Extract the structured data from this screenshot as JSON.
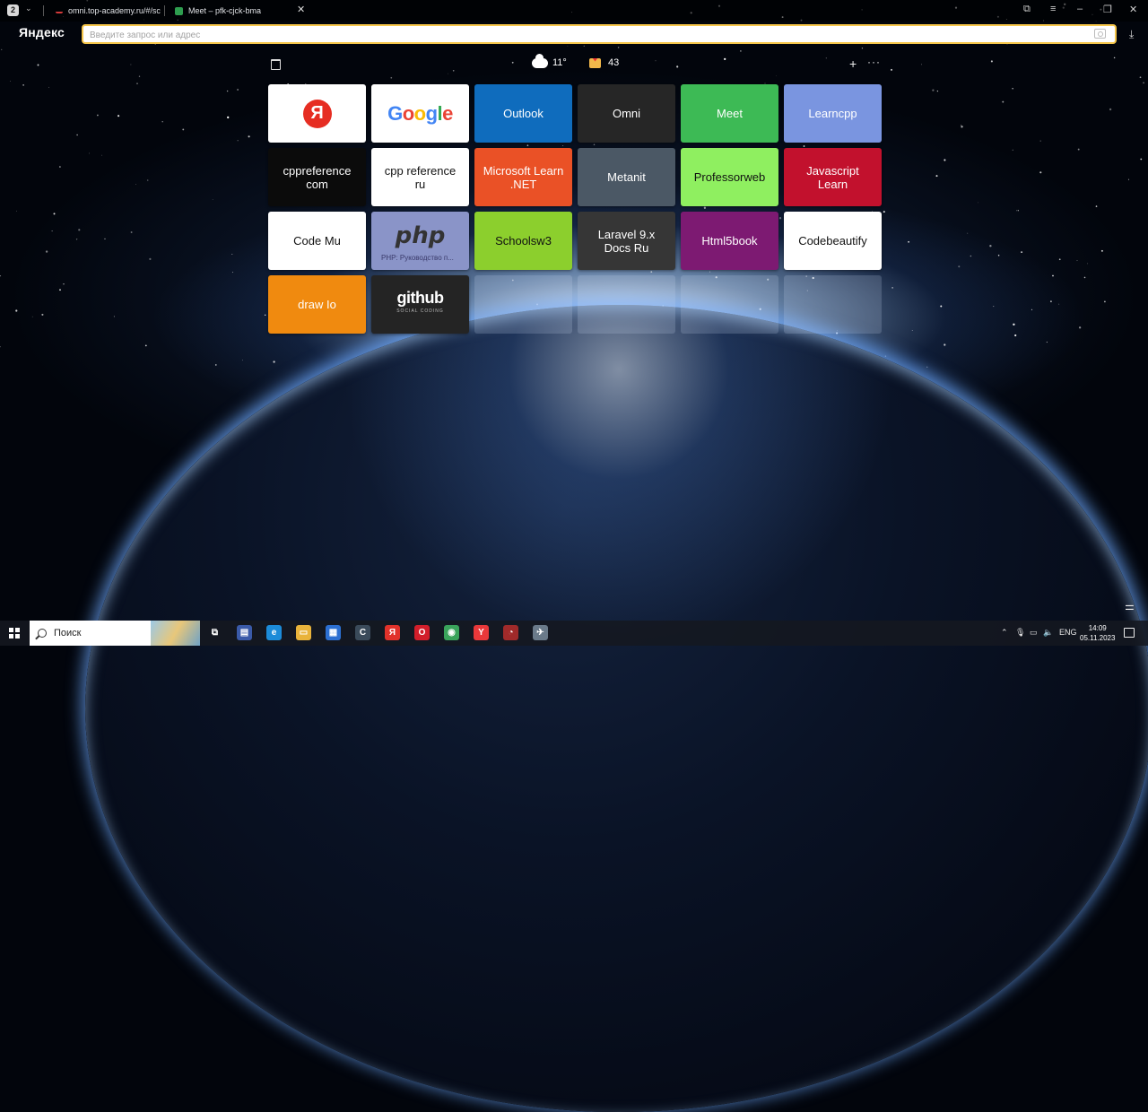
{
  "browser": {
    "tab_count": "2",
    "tabs": [
      {
        "title": "omni.top-academy.ru/#/sc",
        "favicon_color": "#d33a3a"
      },
      {
        "title": "Meet – pfk-cjck-bma",
        "favicon_color": "#2e9e4f"
      }
    ],
    "logo": "Яндекс",
    "omnibox_placeholder": "Введите запрос или адрес"
  },
  "widgets": {
    "weather_temp": "11°",
    "mail_count": "43"
  },
  "tiles": [
    {
      "label": "",
      "kind": "yandex",
      "bg": "#ffffff",
      "color": "#111111"
    },
    {
      "label": "Google",
      "kind": "google",
      "bg": "#ffffff",
      "color": "#4285f4"
    },
    {
      "label": "Outlook",
      "kind": "text",
      "bg": "#0f6cbd",
      "color": "#ffffff"
    },
    {
      "label": "Omni",
      "kind": "text",
      "bg": "#262626",
      "color": "#ffffff"
    },
    {
      "label": "Meet",
      "kind": "text",
      "bg": "#3dba55",
      "color": "#ffffff"
    },
    {
      "label": "Learncpp",
      "kind": "text",
      "bg": "#7a95e0",
      "color": "#ffffff"
    },
    {
      "label": "cppreference com",
      "kind": "text",
      "bg": "#0b0b0b",
      "color": "#ffffff"
    },
    {
      "label": "cpp reference ru",
      "kind": "text",
      "bg": "#ffffff",
      "color": "#111111"
    },
    {
      "label": "Microsoft Learn .NET",
      "kind": "text",
      "bg": "#ea5126",
      "color": "#ffffff"
    },
    {
      "label": "Metanit",
      "kind": "text",
      "bg": "#4b5865",
      "color": "#ffffff"
    },
    {
      "label": "Professorweb",
      "kind": "text",
      "bg": "#8fef60",
      "color": "#111111"
    },
    {
      "label": "Javascript Learn",
      "kind": "text",
      "bg": "#c2112d",
      "color": "#ffffff"
    },
    {
      "label": "Code Mu",
      "kind": "text",
      "bg": "#ffffff",
      "color": "#111111"
    },
    {
      "label": "php",
      "kind": "php",
      "bg": "#8a94c8",
      "color": "#333333",
      "sub": "PHP: Руководство п..."
    },
    {
      "label": "Schoolsw3",
      "kind": "text",
      "bg": "#8ccf2d",
      "color": "#111111"
    },
    {
      "label": "Laravel 9.x Docs Ru",
      "kind": "text",
      "bg": "#363636",
      "color": "#ffffff"
    },
    {
      "label": "Html5book",
      "kind": "text",
      "bg": "#7d1a72",
      "color": "#ffffff"
    },
    {
      "label": "Codebeautify",
      "kind": "text",
      "bg": "#ffffff",
      "color": "#111111"
    },
    {
      "label": "draw Io",
      "kind": "text",
      "bg": "#f08a0f",
      "color": "#ffffff"
    },
    {
      "label": "github",
      "kind": "github",
      "bg": "#242424",
      "color": "#ffffff",
      "sub": "SOCIAL CODING"
    },
    {
      "label": "",
      "kind": "empty"
    },
    {
      "label": "",
      "kind": "empty"
    },
    {
      "label": "",
      "kind": "empty"
    },
    {
      "label": "",
      "kind": "empty"
    }
  ],
  "taskbar": {
    "search_placeholder": "Поиск",
    "apps": [
      {
        "name": "task-view-icon",
        "glyph": "⧉",
        "bg": "transparent"
      },
      {
        "name": "notes-app-icon",
        "glyph": "▤",
        "bg": "#3a5aa8"
      },
      {
        "name": "edge-browser-icon",
        "glyph": "e",
        "bg": "#1c8bd8"
      },
      {
        "name": "file-explorer-icon",
        "glyph": "▭",
        "bg": "#e9b33b"
      },
      {
        "name": "store-icon",
        "glyph": "▦",
        "bg": "#2c6fd1"
      },
      {
        "name": "ccleaner-icon",
        "glyph": "C",
        "bg": "#3a4a5a"
      },
      {
        "name": "yandex-app-icon",
        "glyph": "Я",
        "bg": "#e1322a"
      },
      {
        "name": "opera-icon",
        "glyph": "O",
        "bg": "#d21e2a"
      },
      {
        "name": "chrome-icon",
        "glyph": "◉",
        "bg": "#3aa35b"
      },
      {
        "name": "yandex-browser-icon",
        "glyph": "Y",
        "bg": "#e8383a"
      },
      {
        "name": "speed-app-icon",
        "glyph": "◔",
        "bg": "#a02a2a"
      },
      {
        "name": "misc-app-icon",
        "glyph": "✈",
        "bg": "#6a7a8a"
      }
    ],
    "lang": "ENG",
    "time": "14:09",
    "date": "05.11.2023"
  }
}
